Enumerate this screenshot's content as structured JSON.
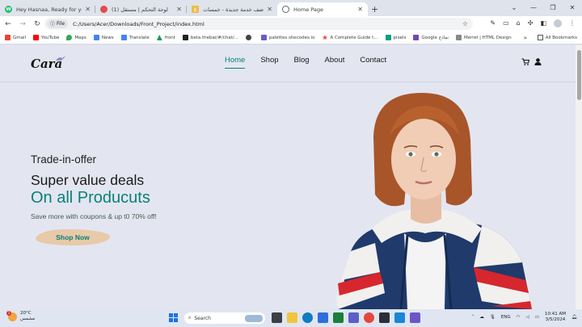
{
  "browser": {
    "tabs": [
      {
        "title": "Hey Hasnaa, Ready for your ne...",
        "favicon_color": "#1dbf73",
        "favicon_text": "W"
      },
      {
        "title": "(1) لوحة التحكم | مستقل",
        "favicon_color": "#e24c4c",
        "favicon_text": ""
      },
      {
        "title": "أضف خدمة جديدة - خمسات",
        "favicon_color": "#f2b94b",
        "favicon_text": "خ"
      },
      {
        "title": "Home Page",
        "favicon_color": "#5f6368",
        "favicon_text": "",
        "active": true
      }
    ],
    "address": {
      "chip": "File",
      "url": "C:/Users/Acer/Downloads/Front_Project/index.html"
    },
    "bookmarks": [
      {
        "label": "Gmail",
        "color": "#ea4335"
      },
      {
        "label": "YouTube",
        "color": "#ff0000"
      },
      {
        "label": "Maps",
        "color": "#34a853"
      },
      {
        "label": "News",
        "color": "#4285f4"
      },
      {
        "label": "Translate",
        "color": "#4285f4"
      },
      {
        "label": "front",
        "color": "#0f9d58"
      },
      {
        "label": "beta.thebai/#/chat/...",
        "color": "#222222"
      },
      {
        "label": "",
        "color": "#444444"
      },
      {
        "label": "palettes.shecodes.io",
        "color": "#6a5acd"
      },
      {
        "label": "A Complete Guide t...",
        "color": "#e8453c"
      },
      {
        "label": "pixels",
        "color": "#05a081"
      },
      {
        "label": "Google نماذج",
        "color": "#7248b9"
      },
      {
        "label": "Merrel | HTML Design",
        "color": "#888888"
      }
    ],
    "bookmarks_more": "»",
    "all_bookmarks": "All Bookmarks"
  },
  "site": {
    "logo": "Cara",
    "nav": [
      "Home",
      "Shop",
      "Blog",
      "About",
      "Contact"
    ],
    "active_nav": "Home",
    "hero": {
      "kicker": "Trade-in-offer",
      "headline": "Super value deals",
      "subheadline": "On all Producuts",
      "tagline": "Save more with coupons & up t0 70% off!",
      "cta": "Shop Now"
    },
    "colors": {
      "accent": "#088178",
      "cta_bg": "#e8c9a8"
    }
  },
  "taskbar": {
    "weather_temp": "20°C",
    "weather_desc": "مشمس",
    "notification_count": "1",
    "search_placeholder": "Search",
    "language": "ENG",
    "time": "10:41 AM",
    "date": "3/5/2024"
  }
}
